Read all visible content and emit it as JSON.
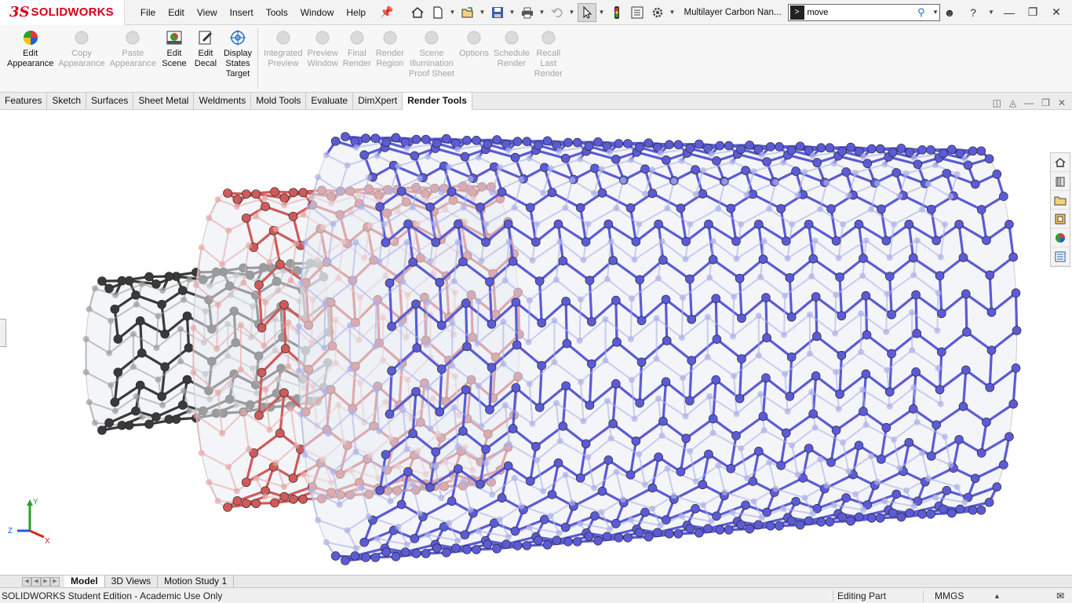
{
  "app": {
    "logo_prefix": "3S",
    "logo_text": "SOLIDWORKS",
    "document_title": "Multilayer Carbon Nan...",
    "brand_color": "#d6001c"
  },
  "menu": [
    "File",
    "Edit",
    "View",
    "Insert",
    "Tools",
    "Window",
    "Help"
  ],
  "search": {
    "value": "move",
    "icon": "search-icon"
  },
  "ribbon": [
    {
      "label": "Edit\nAppearance",
      "icon": "edit-appearance-icon",
      "enabled": true
    },
    {
      "label": "Copy\nAppearance",
      "icon": "copy-appearance-icon",
      "enabled": false
    },
    {
      "label": "Paste\nAppearance",
      "icon": "paste-appearance-icon",
      "enabled": false
    },
    {
      "label": "Edit\nScene",
      "icon": "edit-scene-icon",
      "enabled": true
    },
    {
      "label": "Edit\nDecal",
      "icon": "edit-decal-icon",
      "enabled": true
    },
    {
      "label": "Display\nStates\nTarget",
      "icon": "display-states-target-icon",
      "enabled": true
    },
    {
      "label": "Integrated\nPreview",
      "icon": "integrated-preview-icon",
      "enabled": false
    },
    {
      "label": "Preview\nWindow",
      "icon": "preview-window-icon",
      "enabled": false
    },
    {
      "label": "Final\nRender",
      "icon": "final-render-icon",
      "enabled": false
    },
    {
      "label": "Render\nRegion",
      "icon": "render-region-icon",
      "enabled": false
    },
    {
      "label": "Scene\nIllumination\nProof Sheet",
      "icon": "scene-illumination-icon",
      "enabled": false
    },
    {
      "label": "Options",
      "icon": "options-icon",
      "enabled": false
    },
    {
      "label": "Schedule\nRender",
      "icon": "schedule-render-icon",
      "enabled": false
    },
    {
      "label": "Recall\nLast\nRender",
      "icon": "recall-last-render-icon",
      "enabled": false
    }
  ],
  "tabs": [
    {
      "label": "Features",
      "active": false
    },
    {
      "label": "Sketch",
      "active": false
    },
    {
      "label": "Surfaces",
      "active": false
    },
    {
      "label": "Sheet Metal",
      "active": false
    },
    {
      "label": "Weldments",
      "active": false
    },
    {
      "label": "Mold Tools",
      "active": false
    },
    {
      "label": "Evaluate",
      "active": false
    },
    {
      "label": "DimXpert",
      "active": false
    },
    {
      "label": "Render Tools",
      "active": true
    }
  ],
  "triad": {
    "x": "X",
    "y": "Y",
    "z": "Z"
  },
  "model_tabs": [
    {
      "label": "Model",
      "active": true
    },
    {
      "label": "3D Views",
      "active": false
    },
    {
      "label": "Motion Study 1",
      "active": false
    }
  ],
  "status": {
    "left": "SOLIDWORKS Student Edition - Academic Use Only",
    "mode": "Editing Part",
    "units": "MMGS"
  },
  "colors": {
    "outer_tube": "#5b5bd6",
    "middle_tube": "#d05a5a",
    "inner_tube": "#3a3a3a",
    "accent": "#1b6ac9"
  }
}
